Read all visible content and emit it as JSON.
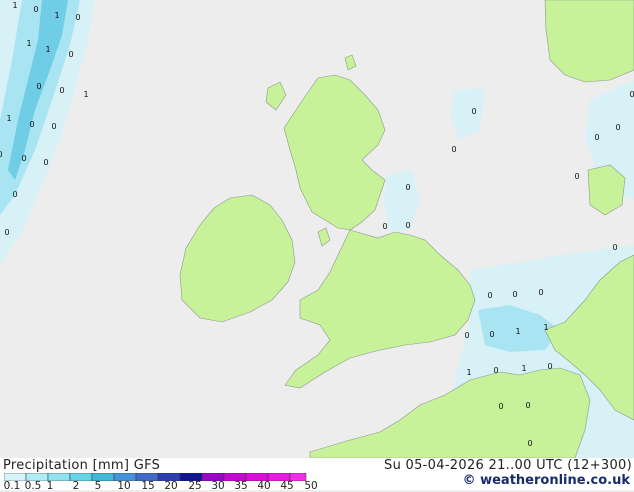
{
  "legend": {
    "title": "Precipitation [mm]  GFS",
    "run_time": "Su 05-04-2026 21..00 UTC (12+300)",
    "credit": "© weatheronline.co.uk",
    "ticks": [
      "0.1",
      "0.5",
      "1",
      "2",
      "5",
      "10",
      "15",
      "20",
      "25",
      "30",
      "35",
      "40",
      "45",
      "50"
    ],
    "colors": [
      "#d6f5f9",
      "#aeedf5",
      "#8ee3ef",
      "#64d4e6",
      "#42b8d8",
      "#4593dc",
      "#4169c8",
      "#2b3fae",
      "#12158e",
      "#9b07c7",
      "#c30ad0",
      "#d90ed8",
      "#e61ae0",
      "#f02ee6"
    ]
  },
  "map": {
    "land_color": "#c7f29a",
    "sea_color": "#ededed",
    "precip_light": "#d8f1f7",
    "precip_mid": "#a9e4f2",
    "precip_strong": "#6fcde6",
    "labels": [
      "1",
      "0",
      "0",
      "1",
      "1",
      "0",
      "1",
      "0",
      "0",
      "1",
      "0",
      "0",
      "1",
      "0",
      "0",
      "0",
      "0",
      "0",
      "0",
      "0",
      "0",
      "0",
      "0",
      "0",
      "0",
      "0",
      "0",
      "0",
      "0",
      "1",
      "1",
      "1",
      "0",
      "1",
      "0",
      "0",
      "0",
      "0",
      "0",
      "0",
      "0",
      "0"
    ]
  }
}
